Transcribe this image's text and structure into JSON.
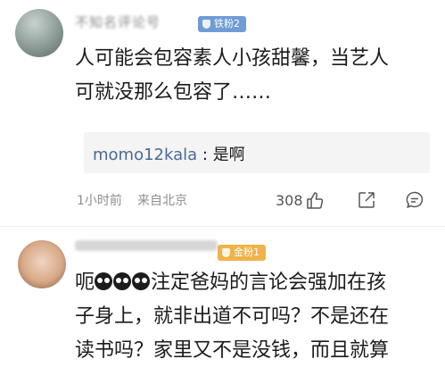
{
  "comments": [
    {
      "username": "不知名评论号",
      "badge": "铁粉2",
      "lines": [
        "人可能会包容素人小孩甜馨，当艺人",
        "可就没那么包容了……"
      ],
      "reply": {
        "user": "momo12kala",
        "separator": " : ",
        "text": "是啊"
      },
      "time": "1小时前",
      "location": "来自北京",
      "likes": "308"
    },
    {
      "username": "",
      "badge": "金粉1",
      "lines": [
        {
          "prefix": "呃",
          "emoji_count": 3,
          "text": "注定爸妈的言论会强加在孩"
        },
        "子身上，就非出道不可吗？不是还在",
        "读书吗？家里又不是没钱，而且就算"
      ]
    }
  ],
  "icons": [
    "like-icon",
    "share-icon",
    "comment-icon",
    "badge-icon"
  ]
}
